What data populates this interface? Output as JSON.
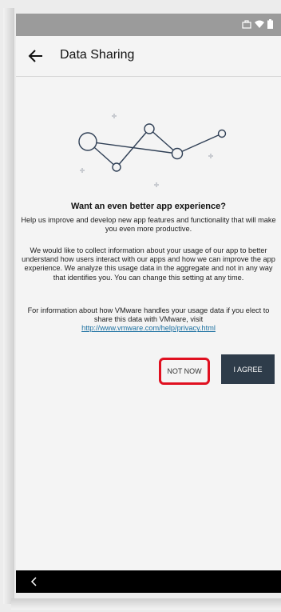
{
  "app_bar": {
    "title": "Data Sharing"
  },
  "content": {
    "heading": "Want an even better app experience?",
    "paragraph1": "Help us improve and develop new app features and functionality that will make you even more productive.",
    "paragraph2": "We would like to collect information about your usage of our app to better understand how users interact with our apps and how we can improve the app experience. We analyze this usage data in the aggregate and not in any way that identifies you. You can change this setting at any time.",
    "paragraph3": "For information about how VMware handles your usage data if you elect to share this data with VMware, visit",
    "privacy_link": "http://www.vmware.com/help/privacy.html"
  },
  "buttons": {
    "not_now": "NOT NOW",
    "agree": "I AGREE"
  },
  "colors": {
    "status_bar": "#9b9b9b",
    "agree_button": "#2e3c4a",
    "highlight_border": "#e01020",
    "link": "#1a6fa0"
  }
}
